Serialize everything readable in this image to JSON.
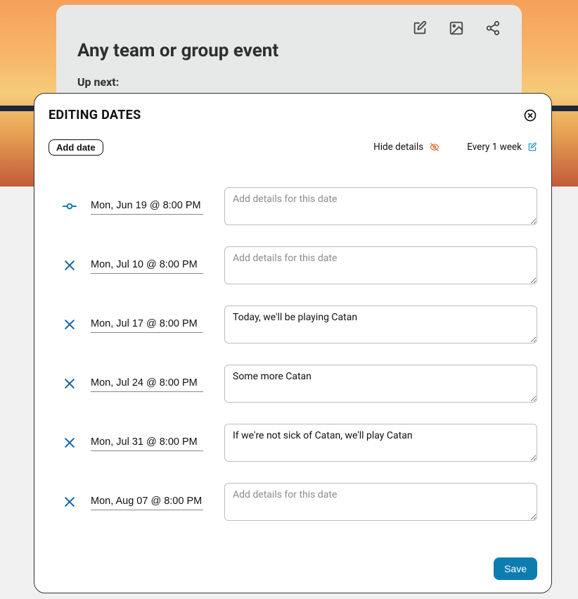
{
  "background_card": {
    "title": "Any team or group event",
    "up_next_label": "Up next:"
  },
  "modal": {
    "title": "EDITING DATES",
    "add_date_label": "Add date",
    "hide_details_label": "Hide details",
    "recurrence_label": "Every 1 week",
    "details_placeholder": "Add details for this date",
    "save_label": "Save",
    "rows": [
      {
        "icon": "commit",
        "date": "Mon, Jun 19 @ 8:00 PM",
        "details": ""
      },
      {
        "icon": "x",
        "date": "Mon, Jul 10 @ 8:00 PM",
        "details": ""
      },
      {
        "icon": "x",
        "date": "Mon, Jul 17 @ 8:00 PM",
        "details": "Today, we'll be playing Catan"
      },
      {
        "icon": "x",
        "date": "Mon, Jul 24 @ 8:00 PM",
        "details": "Some more Catan"
      },
      {
        "icon": "x",
        "date": "Mon, Jul 31 @ 8:00 PM",
        "details": "If we're not sick of Catan, we'll play Catan"
      },
      {
        "icon": "x",
        "date": "Mon, Aug 07 @ 8:00 PM",
        "details": ""
      }
    ]
  }
}
